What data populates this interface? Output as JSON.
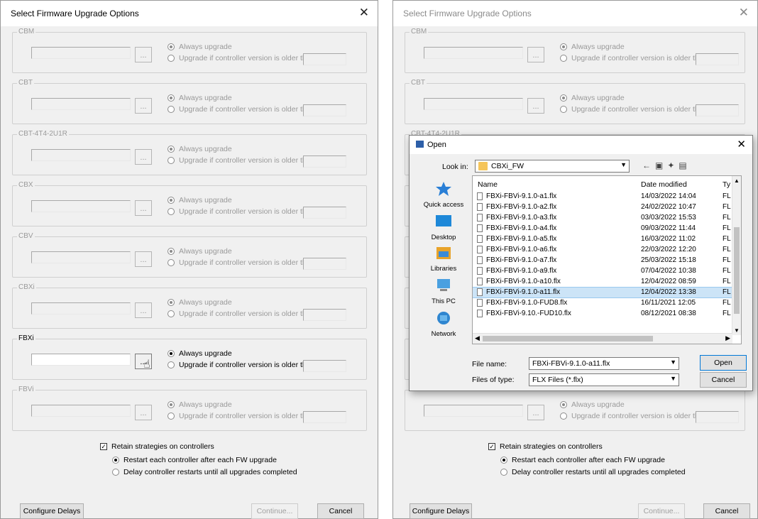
{
  "left": {
    "title": "Select Firmware Upgrade Options",
    "close_label": "✕",
    "groups": [
      {
        "name": "CBM",
        "browse": "...",
        "opt1": "Always upgrade",
        "opt2": "Upgrade if controller version is older than:"
      },
      {
        "name": "CBT",
        "browse": "...",
        "opt1": "Always upgrade",
        "opt2": "Upgrade if controller version is older than:"
      },
      {
        "name": "CBT-4T4-2U1R",
        "browse": "...",
        "opt1": "Always upgrade",
        "opt2": "Upgrade if controller version is older than:"
      },
      {
        "name": "CBX",
        "browse": "...",
        "opt1": "Always upgrade",
        "opt2": "Upgrade if controller version is older than:"
      },
      {
        "name": "CBV",
        "browse": "...",
        "opt1": "Always upgrade",
        "opt2": "Upgrade if controller version is older than:"
      },
      {
        "name": "CBXi",
        "browse": "...",
        "opt1": "Always upgrade",
        "opt2": "Upgrade if controller version is older than:"
      },
      {
        "name": "FBXi",
        "browse": "...",
        "opt1": "Always upgrade",
        "opt2": "Upgrade if controller version is older than:"
      },
      {
        "name": "FBVi",
        "browse": "...",
        "opt1": "Always upgrade",
        "opt2": "Upgrade if controller version is older than:"
      }
    ],
    "retain_label": "Retain strategies on controllers",
    "restart_label": "Restart each controller after each FW upgrade",
    "delay_label": "Delay controller restarts until all upgrades completed",
    "configure_delays": "Configure Delays",
    "continue": "Continue...",
    "cancel": "Cancel"
  },
  "right": {
    "title": "Select Firmware Upgrade Options",
    "close_label": "✕",
    "groups": [
      {
        "name": "CBM",
        "browse": "...",
        "opt1": "Always upgrade",
        "opt2": "Upgrade if controller version is older than:"
      },
      {
        "name": "CBT",
        "browse": "...",
        "opt1": "Always upgrade",
        "opt2": "Upgrade if controller version is older than:"
      },
      {
        "name": "CBT-4T4-2U1R",
        "browse": "...",
        "opt1": "Always upgrade",
        "opt2": "Upgrade if controller version is older than:"
      },
      {
        "name": "",
        "browse": "...",
        "opt1": "Always upgrade",
        "opt2": "Upgrade if controller version is older than:"
      }
    ],
    "retain_label": "Retain strategies on controllers",
    "restart_label": "Restart each controller after each FW upgrade",
    "delay_label": "Delay controller restarts until all upgrades completed",
    "configure_delays": "Configure Delays",
    "continue": "Continue...",
    "cancel": "Cancel"
  },
  "open_dialog": {
    "title": "Open",
    "close_label": "✕",
    "look_in_label": "Look in:",
    "look_in_value": "CBXi_FW",
    "places": [
      "Quick access",
      "Desktop",
      "Libraries",
      "This PC",
      "Network"
    ],
    "columns": {
      "name": "Name",
      "date": "Date modified",
      "type": "Ty"
    },
    "files": [
      {
        "name": "FBXi-FBVi-9.1.0-a1.flx",
        "date": "14/03/2022 14:04",
        "type": "FL"
      },
      {
        "name": "FBXi-FBVi-9.1.0-a2.flx",
        "date": "24/02/2022 10:47",
        "type": "FL"
      },
      {
        "name": "FBXi-FBVi-9.1.0-a3.flx",
        "date": "03/03/2022 15:53",
        "type": "FL"
      },
      {
        "name": "FBXi-FBVi-9.1.0-a4.flx",
        "date": "09/03/2022 11:44",
        "type": "FL"
      },
      {
        "name": "FBXi-FBVi-9.1.0-a5.flx",
        "date": "16/03/2022 11:02",
        "type": "FL"
      },
      {
        "name": "FBXi-FBVi-9.1.0-a6.flx",
        "date": "22/03/2022 12:20",
        "type": "FL"
      },
      {
        "name": "FBXi-FBVi-9.1.0-a7.flx",
        "date": "25/03/2022 15:18",
        "type": "FL"
      },
      {
        "name": "FBXi-FBVi-9.1.0-a9.flx",
        "date": "07/04/2022 10:38",
        "type": "FL"
      },
      {
        "name": "FBXi-FBVi-9.1.0-a10.flx",
        "date": "12/04/2022 08:59",
        "type": "FL"
      },
      {
        "name": "FBXi-FBVi-9.1.0-a11.flx",
        "date": "12/04/2022 13:38",
        "type": "FL"
      },
      {
        "name": "FBXi-FBVi-9.1.0-FUD8.flx",
        "date": "16/11/2021 12:05",
        "type": "FL"
      },
      {
        "name": "FBXi-FBVi-9.10.-FUD10.flx",
        "date": "08/12/2021 08:38",
        "type": "FL"
      }
    ],
    "selected_index": 9,
    "file_name_label": "File name:",
    "file_name_value": "FBXi-FBVi-9.1.0-a11.flx",
    "files_of_type_label": "Files of type:",
    "files_of_type_value": "FLX Files (*.flx)",
    "open": "Open",
    "cancel": "Cancel"
  },
  "colors": {
    "dialog_bg": "#f0f0f0",
    "selection": "#cce4f7",
    "disabled_text": "#9a9a9a"
  }
}
